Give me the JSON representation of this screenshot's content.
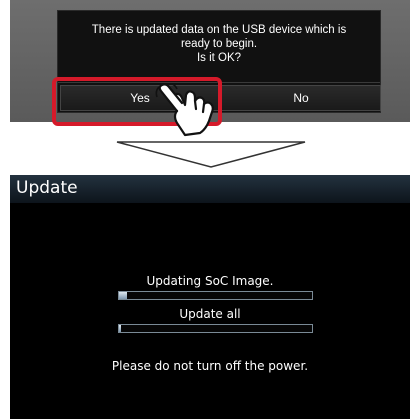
{
  "dialog": {
    "message_line1": "There is updated data on the USB device which is",
    "message_line2": "ready to begin.",
    "message_line3": "Is it OK?",
    "yes_label": "Yes",
    "no_label": "No"
  },
  "update": {
    "title": "Update",
    "status_soc": "Updating SoC Image.",
    "soc_progress": 0.04,
    "status_all": "Update all",
    "all_progress": 0.01,
    "warning": "Please do not turn off the power."
  },
  "colors": {
    "highlight": "#d51a2a",
    "progress_fill": "#9fb4c8"
  },
  "icons": {
    "pointer": "hand-pointer-icon",
    "transition": "arrow-down-icon"
  }
}
